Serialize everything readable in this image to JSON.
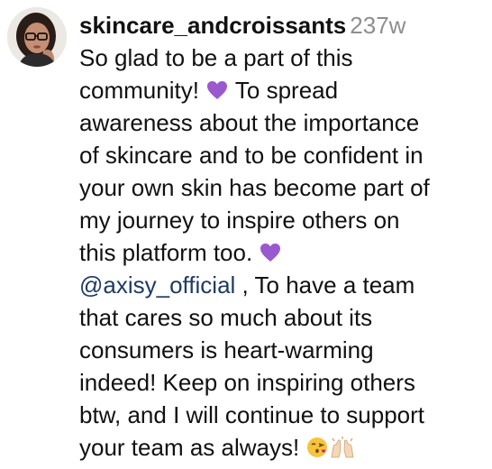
{
  "comment": {
    "username": "skincare_andcroissants",
    "timestamp": "237w",
    "lines": [
      "So glad to be a part of this",
      "community! ",
      " To spread",
      "awareness about the importance",
      "of skincare and to be confident in",
      "your own skin has become part of",
      "my journey to inspire others on",
      "this platform too. ",
      "@axisy_official",
      " , To have a team",
      "that cares so much about its",
      "consumers is heart-warming",
      "indeed! Keep on inspiring others",
      "btw, and I will continue to support",
      "your team as always! "
    ],
    "emojis": [
      "purple-heart",
      "purple-heart",
      "face-blowing-kiss",
      "raising-hands"
    ]
  },
  "colors": {
    "text": "#111111",
    "timestamp": "#8e8e8e",
    "mention": "#1f3b63",
    "purple_heart": "#9b59d0"
  }
}
